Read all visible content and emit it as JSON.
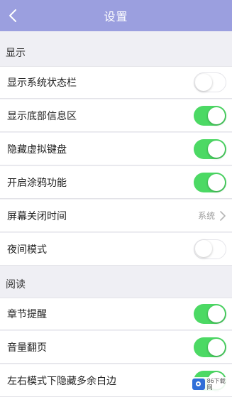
{
  "header": {
    "title": "设置",
    "back_icon": "chevron-left-icon"
  },
  "colors": {
    "header_bg": "#9b9fdf",
    "toggle_on": "#4cd964",
    "page_bg": "#efeff4"
  },
  "sections": [
    {
      "title": "显示",
      "items": [
        {
          "label": "显示系统状态栏",
          "type": "toggle",
          "on": false
        },
        {
          "label": "显示底部信息区",
          "type": "toggle",
          "on": true
        },
        {
          "label": "隐藏虚拟键盘",
          "type": "toggle",
          "on": true
        },
        {
          "label": "开启涂鸦功能",
          "type": "toggle",
          "on": true
        },
        {
          "label": "屏幕关闭时间",
          "type": "select",
          "value": "系统"
        },
        {
          "label": "夜间模式",
          "type": "toggle",
          "on": false
        }
      ]
    },
    {
      "title": "阅读",
      "items": [
        {
          "label": "章节提醒",
          "type": "toggle",
          "on": true
        },
        {
          "label": "音量翻页",
          "type": "toggle",
          "on": true
        },
        {
          "label": "左右模式下隐藏多余白边",
          "type": "toggle",
          "on": true
        }
      ]
    }
  ],
  "watermark": {
    "text": "86下载网"
  }
}
